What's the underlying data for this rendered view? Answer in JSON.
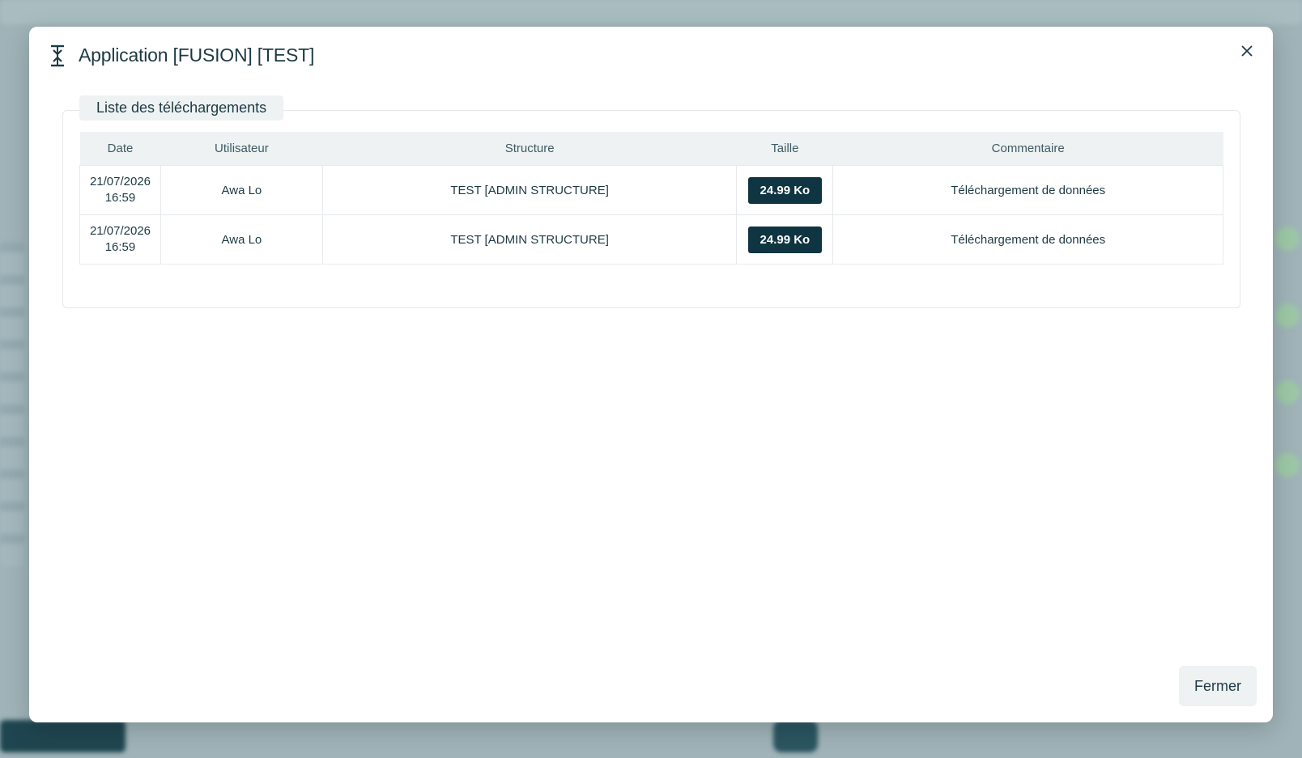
{
  "modal": {
    "title": "Application [FUSION] [TEST]",
    "header_icon": "vertical-align-icon",
    "close_icon": "close-icon",
    "section_title": "Liste des téléchargements",
    "close_button_label": "Fermer"
  },
  "table": {
    "headers": {
      "date": "Date",
      "user": "Utilisateur",
      "structure": "Structure",
      "size": "Taille",
      "comment": "Commentaire"
    },
    "rows": [
      {
        "date": "21/07/2026",
        "time": "16:59",
        "user": "Awa Lo",
        "structure": "TEST [ADMIN STRUCTURE]",
        "size": "24.99 Ko",
        "comment": "Téléchargement de données"
      },
      {
        "date": "21/07/2026",
        "time": "16:59",
        "user": "Awa Lo",
        "structure": "TEST [ADMIN STRUCTURE]",
        "size": "24.99 Ko",
        "comment": "Téléchargement de données"
      }
    ]
  },
  "colors": {
    "accent": "#0f3542",
    "text": "#1d3a44",
    "header_bg": "#eef2f3"
  }
}
